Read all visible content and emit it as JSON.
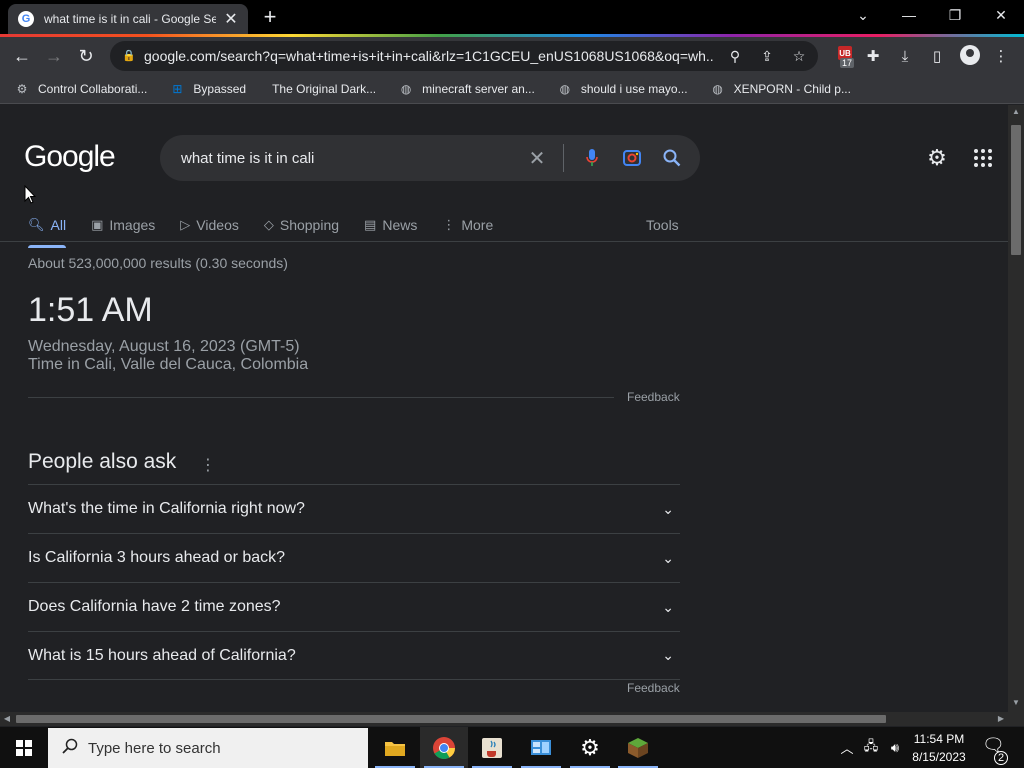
{
  "browser": {
    "tab_title": "what time is it in cali - Google Se",
    "tab_favicon": "G",
    "url": "google.com/search?q=what+time+is+it+in+cali&rlz=1C1GCEU_enUS1068US1068&oq=wh...",
    "extension_count": "17",
    "extension_badge": "UB"
  },
  "bookmarks": [
    {
      "label": "Control Collaborati...",
      "icon": "gear-icon"
    },
    {
      "label": "Bypassed",
      "icon": "windows-icon"
    },
    {
      "label": "The Original Dark...",
      "icon": "blank-icon"
    },
    {
      "label": "minecraft server an...",
      "icon": "globe-icon"
    },
    {
      "label": "should i use mayo...",
      "icon": "globe-icon"
    },
    {
      "label": "XENPORN - Child p...",
      "icon": "globe-icon"
    }
  ],
  "google": {
    "logo": "Google",
    "query": "what time is it in cali",
    "tabs": [
      {
        "label": "All",
        "icon": "search-icon",
        "active": true
      },
      {
        "label": "Images",
        "icon": "image-icon"
      },
      {
        "label": "Videos",
        "icon": "video-icon"
      },
      {
        "label": "Shopping",
        "icon": "tag-icon"
      },
      {
        "label": "News",
        "icon": "news-icon"
      },
      {
        "label": "More",
        "icon": "kebab-icon"
      }
    ],
    "tools_label": "Tools",
    "result_stats": "About 523,000,000 results (0.30 seconds)",
    "clock": {
      "time": "1:51 AM",
      "date": "Wednesday, August 16, 2023 (GMT-5)",
      "place": "Time in Cali, Valle del Cauca, Colombia"
    },
    "feedback_label": "Feedback",
    "paa_title": "People also ask",
    "paa": [
      "What's the time in California right now?",
      "Is California 3 hours ahead or back?",
      "Does California have 2 time zones?",
      "What is 15 hours ahead of California?"
    ]
  },
  "taskbar": {
    "search_placeholder": "Type here to search",
    "time": "11:54 PM",
    "date": "8/15/2023",
    "notification_count": "2"
  },
  "colors": {
    "accent": "#8ab4f8",
    "background": "#202124",
    "toolbar": "#35363a"
  }
}
